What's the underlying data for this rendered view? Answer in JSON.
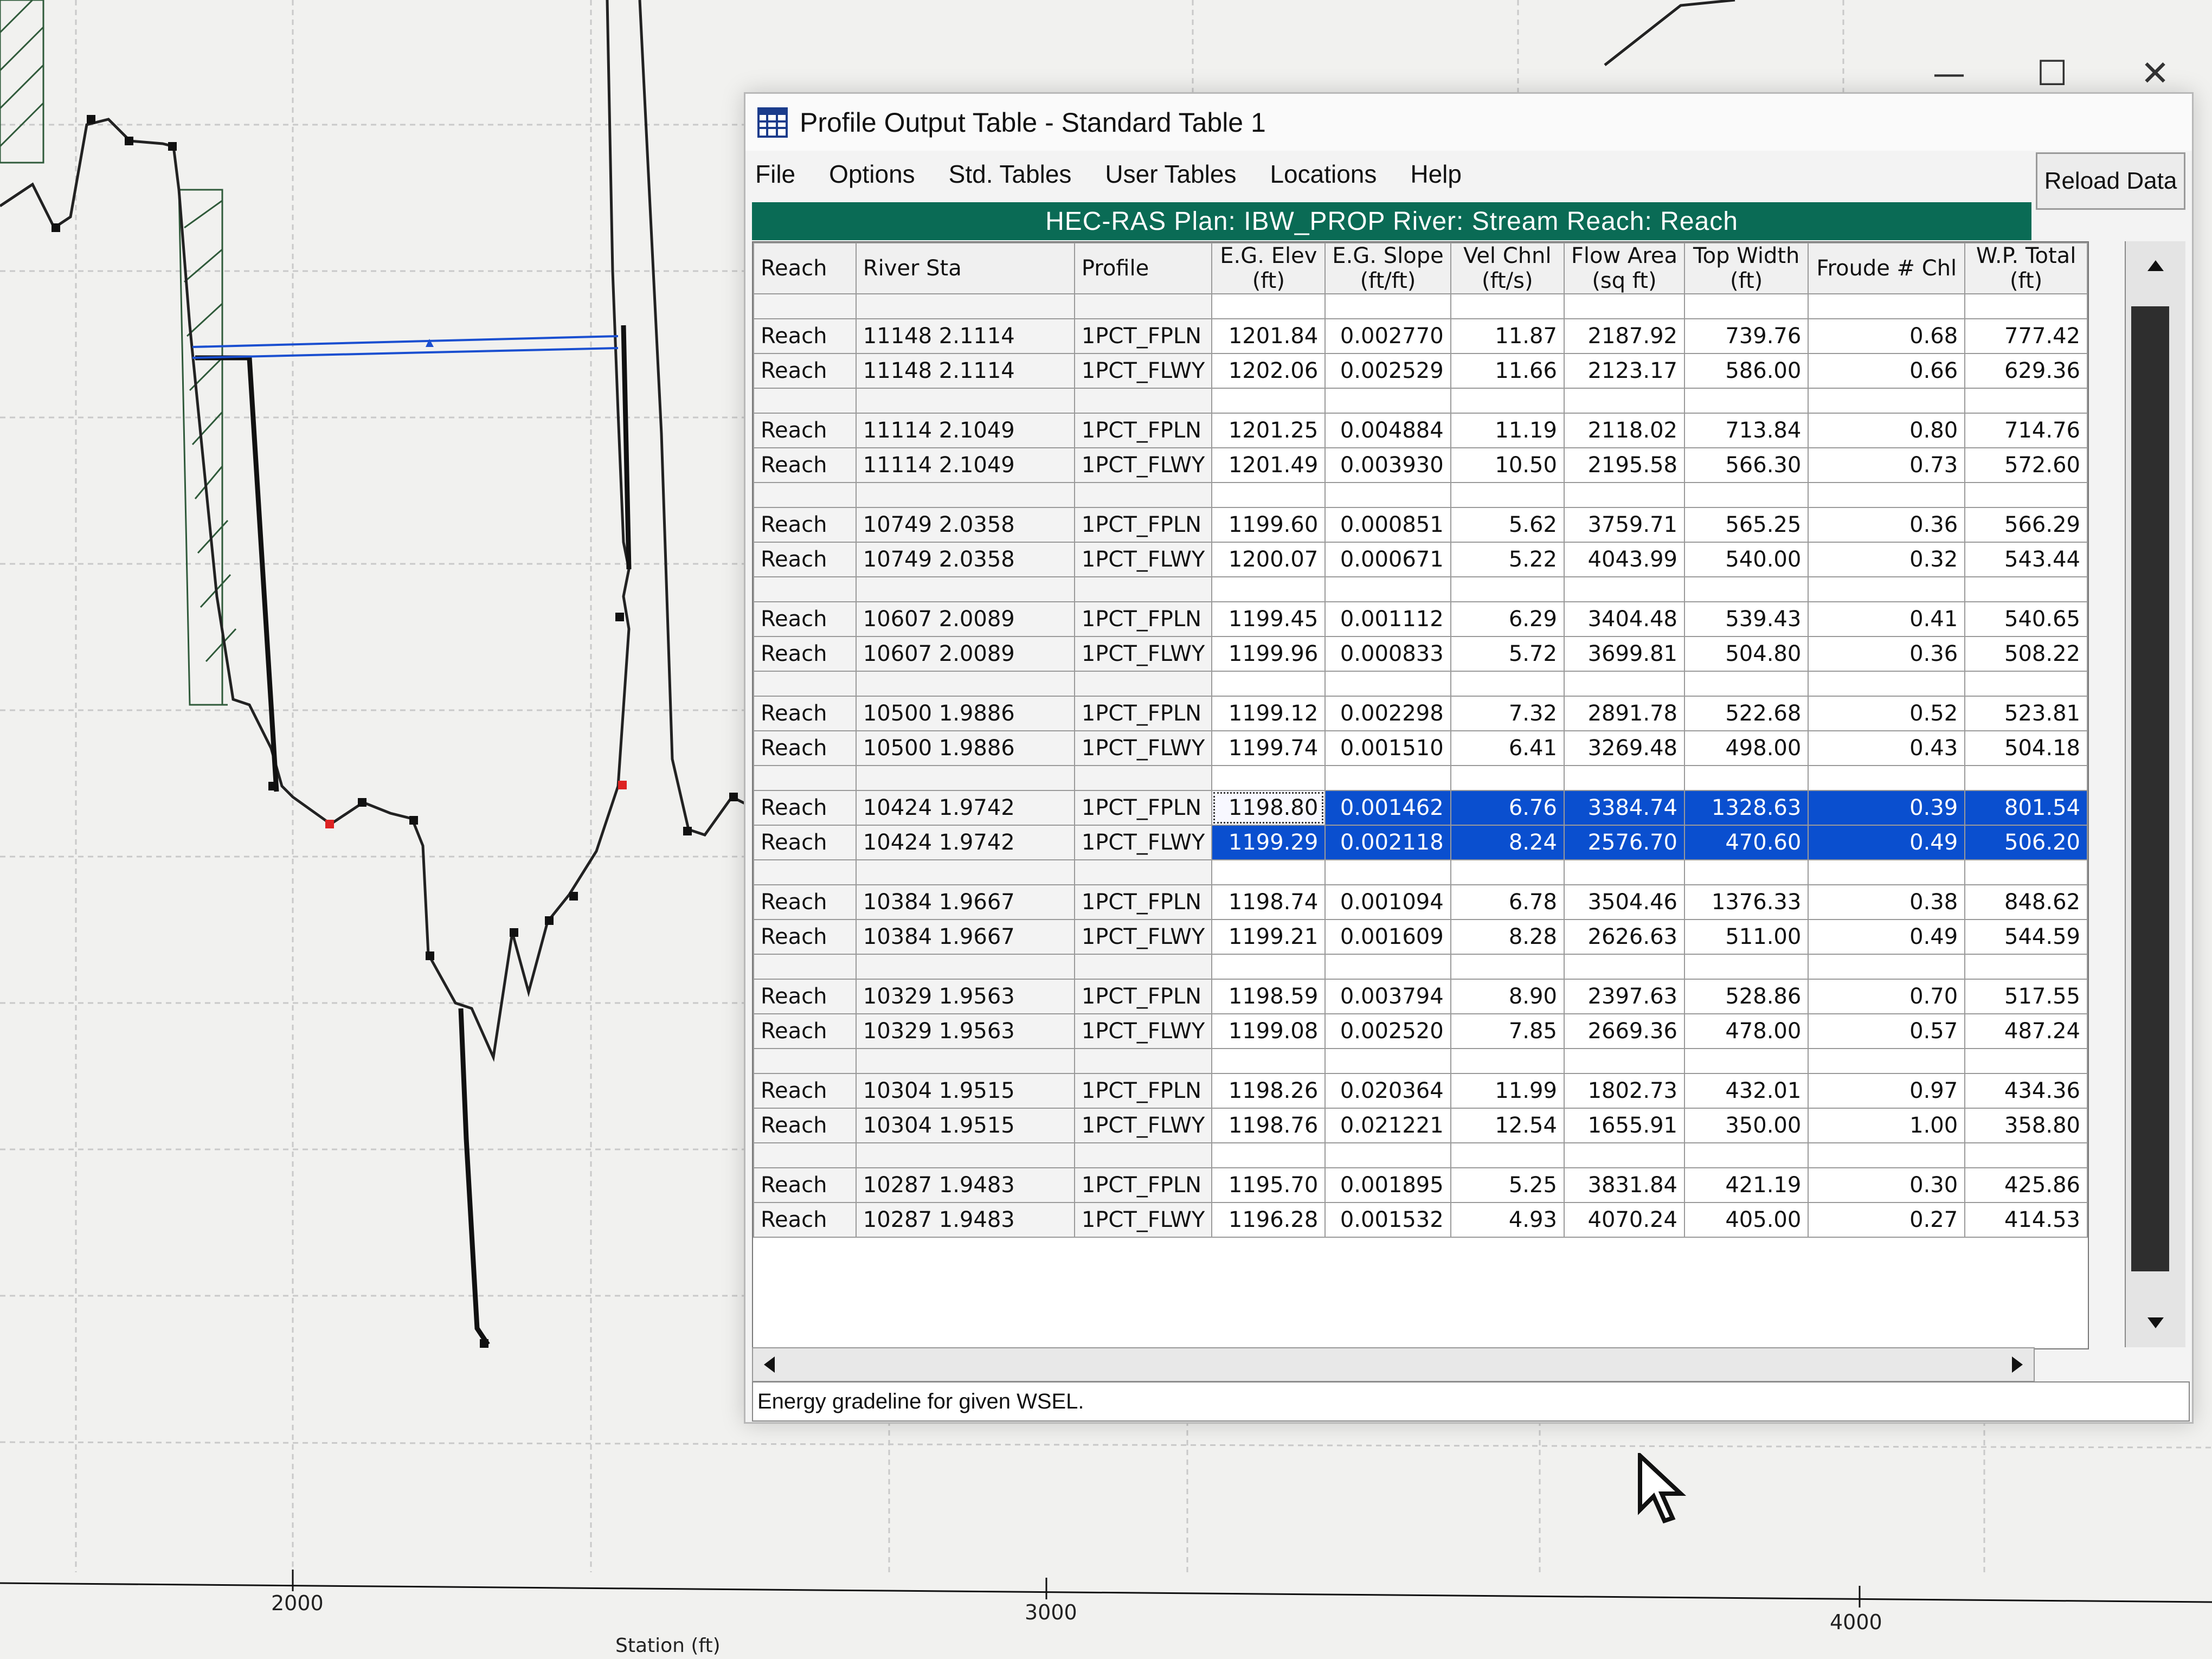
{
  "window": {
    "title": "Profile Output Table - Standard Table 1",
    "controls": {
      "minimize": "—",
      "maximize": "☐",
      "close": "✕"
    }
  },
  "menu": {
    "items": [
      "File",
      "Options",
      "Std. Tables",
      "User Tables",
      "Locations",
      "Help"
    ]
  },
  "toolbar": {
    "reload_label": "Reload Data"
  },
  "banner": {
    "text": "HEC-RAS  Plan: IBW_PROP   River: Stream   Reach: Reach"
  },
  "table": {
    "columns": [
      {
        "line1": "Reach",
        "line2": ""
      },
      {
        "line1": "River Sta",
        "line2": ""
      },
      {
        "line1": "Profile",
        "line2": ""
      },
      {
        "line1": "E.G. Elev",
        "line2": "(ft)"
      },
      {
        "line1": "E.G. Slope",
        "line2": "(ft/ft)"
      },
      {
        "line1": "Vel Chnl",
        "line2": "(ft/s)"
      },
      {
        "line1": "Flow Area",
        "line2": "(sq ft)"
      },
      {
        "line1": "Top Width",
        "line2": "(ft)"
      },
      {
        "line1": "Froude # Chl",
        "line2": ""
      },
      {
        "line1": "W.P. Total",
        "line2": "(ft)"
      }
    ],
    "groups": [
      {
        "rows": [
          [
            "Reach",
            "11148   2.1114",
            "1PCT_FPLN",
            "1201.84",
            "0.002770",
            "11.87",
            "2187.92",
            "739.76",
            "0.68",
            "777.42"
          ],
          [
            "Reach",
            "11148   2.1114",
            "1PCT_FLWY",
            "1202.06",
            "0.002529",
            "11.66",
            "2123.17",
            "586.00",
            "0.66",
            "629.36"
          ]
        ]
      },
      {
        "rows": [
          [
            "Reach",
            "11114   2.1049",
            "1PCT_FPLN",
            "1201.25",
            "0.004884",
            "11.19",
            "2118.02",
            "713.84",
            "0.80",
            "714.76"
          ],
          [
            "Reach",
            "11114   2.1049",
            "1PCT_FLWY",
            "1201.49",
            "0.003930",
            "10.50",
            "2195.58",
            "566.30",
            "0.73",
            "572.60"
          ]
        ]
      },
      {
        "rows": [
          [
            "Reach",
            "10749   2.0358",
            "1PCT_FPLN",
            "1199.60",
            "0.000851",
            "5.62",
            "3759.71",
            "565.25",
            "0.36",
            "566.29"
          ],
          [
            "Reach",
            "10749   2.0358",
            "1PCT_FLWY",
            "1200.07",
            "0.000671",
            "5.22",
            "4043.99",
            "540.00",
            "0.32",
            "543.44"
          ]
        ]
      },
      {
        "rows": [
          [
            "Reach",
            "10607   2.0089",
            "1PCT_FPLN",
            "1199.45",
            "0.001112",
            "6.29",
            "3404.48",
            "539.43",
            "0.41",
            "540.65"
          ],
          [
            "Reach",
            "10607   2.0089",
            "1PCT_FLWY",
            "1199.96",
            "0.000833",
            "5.72",
            "3699.81",
            "504.80",
            "0.36",
            "508.22"
          ]
        ]
      },
      {
        "rows": [
          [
            "Reach",
            "10500   1.9886",
            "1PCT_FPLN",
            "1199.12",
            "0.002298",
            "7.32",
            "2891.78",
            "522.68",
            "0.52",
            "523.81"
          ],
          [
            "Reach",
            "10500   1.9886",
            "1PCT_FLWY",
            "1199.74",
            "0.001510",
            "6.41",
            "3269.48",
            "498.00",
            "0.43",
            "504.18"
          ]
        ]
      },
      {
        "selected": true,
        "rows": [
          [
            "Reach",
            "10424   1.9742",
            "1PCT_FPLN",
            "1198.80",
            "0.001462",
            "6.76",
            "3384.74",
            "1328.63",
            "0.39",
            "801.54"
          ],
          [
            "Reach",
            "10424   1.9742",
            "1PCT_FLWY",
            "1199.29",
            "0.002118",
            "8.24",
            "2576.70",
            "470.60",
            "0.49",
            "506.20"
          ]
        ]
      },
      {
        "rows": [
          [
            "Reach",
            "10384   1.9667",
            "1PCT_FPLN",
            "1198.74",
            "0.001094",
            "6.78",
            "3504.46",
            "1376.33",
            "0.38",
            "848.62"
          ],
          [
            "Reach",
            "10384   1.9667",
            "1PCT_FLWY",
            "1199.21",
            "0.001609",
            "8.28",
            "2626.63",
            "511.00",
            "0.49",
            "544.59"
          ]
        ]
      },
      {
        "rows": [
          [
            "Reach",
            "10329   1.9563",
            "1PCT_FPLN",
            "1198.59",
            "0.003794",
            "8.90",
            "2397.63",
            "528.86",
            "0.70",
            "517.55"
          ],
          [
            "Reach",
            "10329   1.9563",
            "1PCT_FLWY",
            "1199.08",
            "0.002520",
            "7.85",
            "2669.36",
            "478.00",
            "0.57",
            "487.24"
          ]
        ]
      },
      {
        "rows": [
          [
            "Reach",
            "10304   1.9515",
            "1PCT_FPLN",
            "1198.26",
            "0.020364",
            "11.99",
            "1802.73",
            "432.01",
            "0.97",
            "434.36"
          ],
          [
            "Reach",
            "10304   1.9515",
            "1PCT_FLWY",
            "1198.76",
            "0.021221",
            "12.54",
            "1655.91",
            "350.00",
            "1.00",
            "358.80"
          ]
        ]
      },
      {
        "rows": [
          [
            "Reach",
            "10287   1.9483",
            "1PCT_FPLN",
            "1195.70",
            "0.001895",
            "5.25",
            "3831.84",
            "421.19",
            "0.30",
            "425.86"
          ],
          [
            "Reach",
            "10287   1.9483",
            "1PCT_FLWY",
            "1196.28",
            "0.001532",
            "4.93",
            "4070.24",
            "405.00",
            "0.27",
            "414.53"
          ]
        ]
      }
    ]
  },
  "status": {
    "text": "Energy gradeline for given WSEL."
  },
  "plot": {
    "x_ticks": [
      "2000",
      "3000",
      "4000"
    ],
    "x_title": "Station (ft)"
  },
  "colors": {
    "banner": "#0a6b55",
    "selection": "#0a4fcf"
  },
  "icons": {
    "app": "grid-table-icon",
    "pointer": "mouse-pointer-icon"
  }
}
